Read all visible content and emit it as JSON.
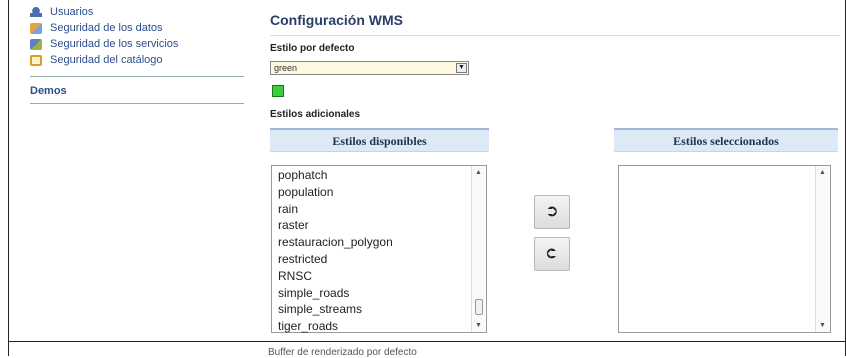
{
  "sidebar": {
    "items": [
      {
        "label": "Usuarios",
        "icon": "users-icon"
      },
      {
        "label": "Seguridad de los datos",
        "icon": "data-security-icon"
      },
      {
        "label": "Seguridad de los servicios",
        "icon": "services-security-icon"
      },
      {
        "label": "Seguridad del catálogo",
        "icon": "catalog-security-icon"
      }
    ],
    "demos": "Demos"
  },
  "main": {
    "title": "Configuración WMS",
    "default_style_label": "Estilo por defecto",
    "default_style_value": "green",
    "default_style_color": "#3ccc3c",
    "additional_styles_label": "Estilos adicionales",
    "available": {
      "header": "Estilos disponibles",
      "items": [
        "pophatch",
        "population",
        "rain",
        "raster",
        "restauracion_polygon",
        "restricted",
        "RNSC",
        "simple_roads",
        "simple_streams",
        "tiger_roads"
      ]
    },
    "selected": {
      "header": "Estilos seleccionados",
      "items": []
    },
    "move_right_symbol": "➲",
    "move_left_symbol": "➲",
    "footer_partial": "Buffer de renderizado por defecto"
  },
  "colors": {
    "link": "#2a4e8c",
    "header_bg": "#dde9f5",
    "select_bg": "#fff8e0"
  }
}
